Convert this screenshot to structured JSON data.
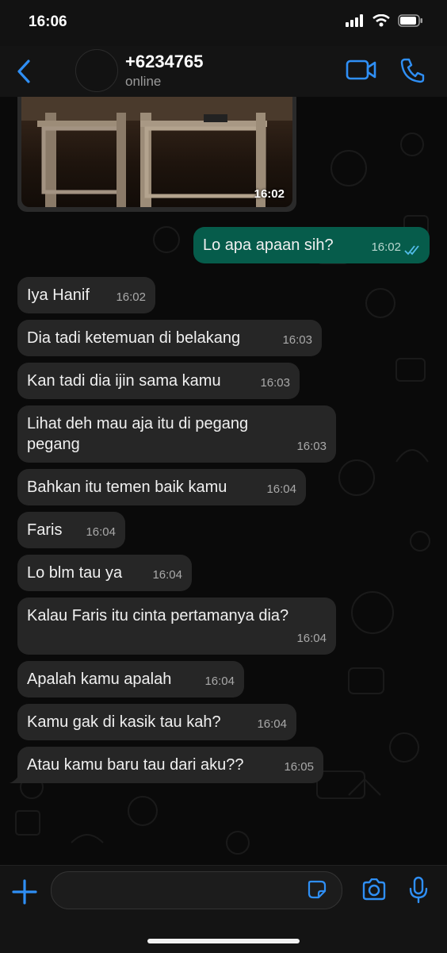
{
  "status_bar": {
    "time": "16:06"
  },
  "header": {
    "contact_name": "+6234765",
    "presence": "online"
  },
  "chat": {
    "image_message": {
      "time": "16:02"
    },
    "messages": [
      {
        "direction": "out",
        "text": "Lo apa apaan sih?",
        "time": "16:02"
      },
      {
        "direction": "in",
        "text": "Iya Hanif",
        "time": "16:02"
      },
      {
        "direction": "in",
        "text": "Dia tadi ketemuan di belakang",
        "time": "16:03"
      },
      {
        "direction": "in",
        "text": "Kan tadi dia ijin sama kamu",
        "time": "16:03"
      },
      {
        "direction": "in",
        "text": "Lihat deh mau aja itu di pegang pegang",
        "time": "16:03"
      },
      {
        "direction": "in",
        "text": "Bahkan itu temen baik kamu",
        "time": "16:04"
      },
      {
        "direction": "in",
        "text": "Faris",
        "time": "16:04"
      },
      {
        "direction": "in",
        "text": "Lo blm tau ya",
        "time": "16:04"
      },
      {
        "direction": "in",
        "text": "Kalau Faris itu cinta pertamanya dia?",
        "time": "16:04"
      },
      {
        "direction": "in",
        "text": "Apalah kamu apalah",
        "time": "16:04"
      },
      {
        "direction": "in",
        "text": "Kamu gak di kasik tau kah?",
        "time": "16:04"
      },
      {
        "direction": "in",
        "text": "Atau kamu baru tau dari aku??",
        "time": "16:05"
      }
    ]
  },
  "colors": {
    "accent": "#2f8ff5",
    "outgoing_bubble": "#065c4b",
    "incoming_bubble": "#262626",
    "read_ticks": "#53bdeb"
  }
}
